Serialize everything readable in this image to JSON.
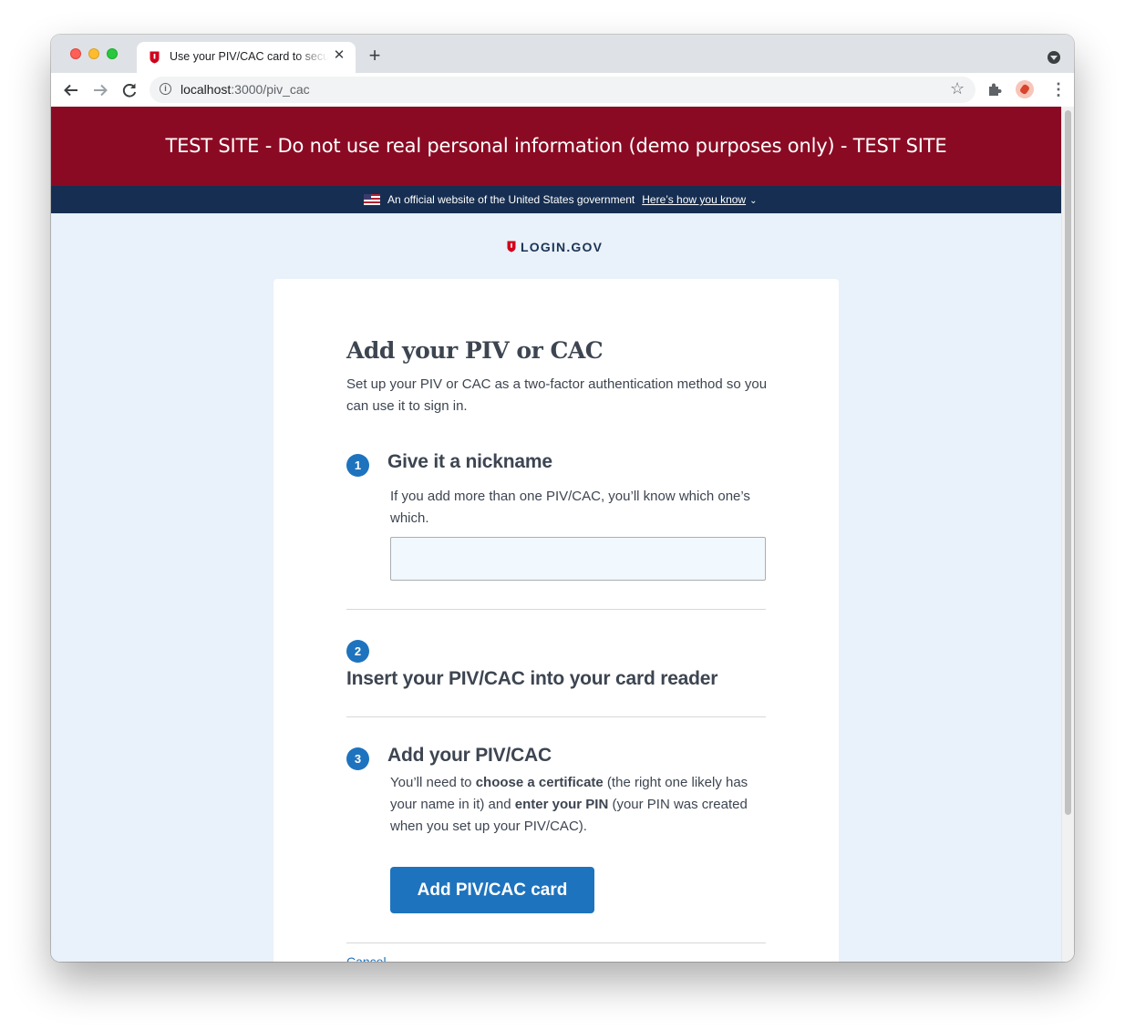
{
  "browser": {
    "tab_title": "Use your PIV/CAC card to secure your account",
    "tab_close": "✕",
    "new_tab": "+",
    "url_host": "localhost",
    "url_path": ":3000/piv_cac",
    "info_glyph": "i",
    "bookmark_glyph": "☆",
    "menu_glyph": "⋮",
    "icons": [
      "back-arrow-icon",
      "forward-arrow-icon",
      "reload-icon",
      "site-info-icon",
      "bookmark-star-icon",
      "extensions-puzzle-icon",
      "profile-avatar-icon",
      "browser-menu-icon",
      "tab-search-icon"
    ]
  },
  "test_banner": {
    "text": "TEST SITE - Do not use real personal information (demo purposes only) - TEST SITE",
    "color": "#8b0a23"
  },
  "gov_banner": {
    "text": "An official website of the United States government",
    "link": "Here’s how you know",
    "color": "#162e51"
  },
  "logo": {
    "text": "LOGIN.GOV"
  },
  "card": {
    "title": "Add your PIV or CAC",
    "intro": "Set up your PIV or CAC as a two-factor authentication method so you can use it to sign in."
  },
  "steps": [
    {
      "number": "1",
      "heading": "Give it a nickname",
      "text": "If you add more than one PIV/CAC, you’ll know which one’s which."
    },
    {
      "number": "2",
      "heading": "Insert your PIV/CAC into your card reader"
    },
    {
      "number": "3",
      "heading": "Add your PIV/CAC",
      "text_parts": [
        "You’ll need to ",
        "choose a certificate",
        " (the right one likely has your name in it) and ",
        "enter your PIN",
        " (your PIN was created when you set up your PIV/CAC)."
      ]
    }
  ],
  "nickname_input": {
    "value": "",
    "placeholder": ""
  },
  "buttons": {
    "add": "Add PIV/CAC card"
  },
  "links": {
    "cancel": "Cancel"
  },
  "colors": {
    "primary": "#1e73be",
    "page_background": "#e9f1fa"
  }
}
